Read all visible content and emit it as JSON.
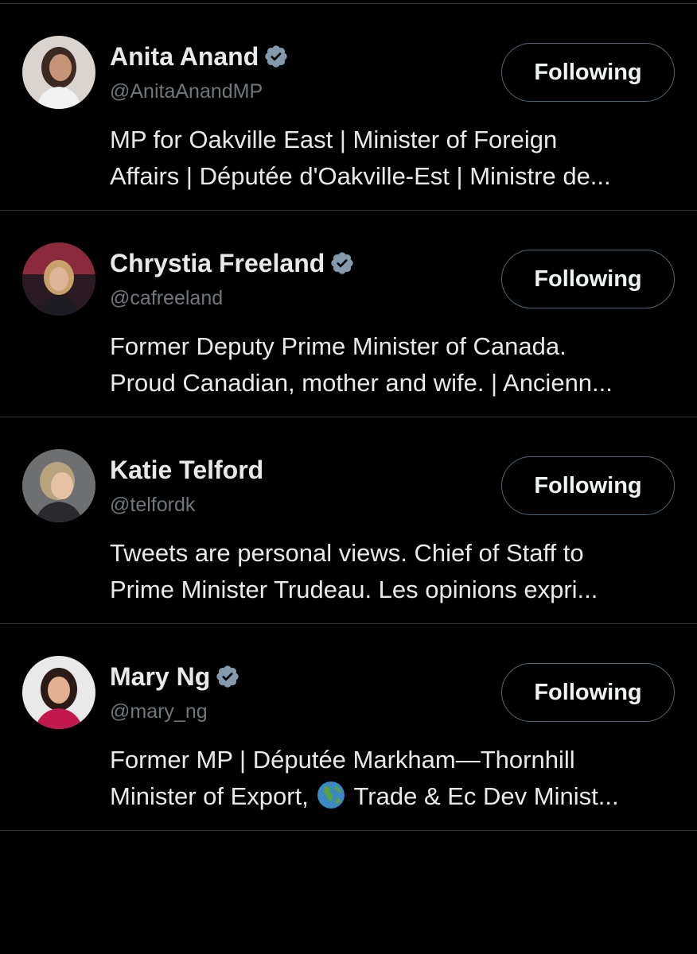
{
  "accounts": [
    {
      "name": "Anita Anand",
      "handle": "@AnitaAnandMP",
      "verified": true,
      "bio_line1": "MP for Oakville East | Minister of Foreign",
      "bio_line2": "Affairs | Députée d'Oakville-Est | Ministre de...",
      "button_label": "Following"
    },
    {
      "name": "Chrystia Freeland",
      "handle": "@cafreeland",
      "verified": true,
      "bio_line1": "Former Deputy Prime Minister of Canada.",
      "bio_line2": "Proud Canadian, mother and wife. | Ancienn...",
      "button_label": "Following"
    },
    {
      "name": "Katie Telford",
      "handle": "@telfordk",
      "verified": false,
      "bio_line1": "Tweets are personal views. Chief of Staff to",
      "bio_line2": "Prime Minister Trudeau. Les opinions expri...",
      "button_label": "Following"
    },
    {
      "name": "Mary Ng",
      "handle": "@mary_ng",
      "verified": true,
      "bio_line1": "Former MP | Députée Markham—Thornhill",
      "bio_line2_before_icon": "Minister of Export,",
      "bio_line2_icon": "globe-emoji-icon",
      "bio_line2_after_icon": "Trade & Ec Dev Minist...",
      "button_label": "Following"
    }
  ],
  "colors": {
    "background": "#000000",
    "primary_text": "#e7e9ea",
    "secondary_text": "#71767b",
    "divider": "#2f3336",
    "button_border": "#536471",
    "verified_badge": "#829aab"
  },
  "icons": {
    "verified": "verified-badge-icon",
    "globe": "globe-emoji-icon"
  }
}
